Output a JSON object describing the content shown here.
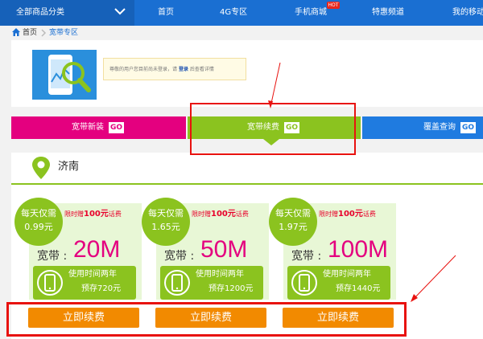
{
  "nav": {
    "category": "全部商品分类",
    "items": [
      "首页",
      "4G专区",
      "手机商城",
      "特惠频道",
      "我的移动"
    ],
    "hot_badge": "HOT"
  },
  "breadcrumb": {
    "home": "首页",
    "current": "宽带专区"
  },
  "notice": {
    "before": "尊敬的用户您目前尚未登录，请",
    "login": "登录",
    "after": "后查看详情"
  },
  "tabs": [
    {
      "label": "宽带新装",
      "go": "GO",
      "color": "#e4007f"
    },
    {
      "label": "宽带续费",
      "go": "GO",
      "color": "#8bc31f"
    },
    {
      "label": "覆盖查询",
      "go": "GO",
      "color": "#1f7be0"
    }
  ],
  "city": "济南",
  "plans": [
    {
      "daily_label": "每天仅需",
      "daily_price": "0.99元",
      "promo_pre": "限时赠",
      "promo_amount": "100元",
      "promo_post": "话费",
      "bb_label": "宽带 :",
      "speed": "20M",
      "use_period": "使用时间两年",
      "prestore": "预存720元",
      "button": "立即续费"
    },
    {
      "daily_label": "每天仅需",
      "daily_price": "1.65元",
      "promo_pre": "限时赠",
      "promo_amount": "100元",
      "promo_post": "话费",
      "bb_label": "宽带 :",
      "speed": "50M",
      "use_period": "使用时间两年",
      "prestore": "预存1200元",
      "button": "立即续费"
    },
    {
      "daily_label": "每天仅需",
      "daily_price": "1.97元",
      "promo_pre": "限时赠",
      "promo_amount": "100元",
      "promo_post": "话费",
      "bb_label": "宽带 :",
      "speed": "100M",
      "use_period": "使用时间两年",
      "prestore": "预存1440元",
      "button": "立即续费"
    }
  ],
  "colors": {
    "nav_blue": "#1a6fd2",
    "green": "#8bc31f",
    "magenta": "#e4007f",
    "orange": "#f28a00",
    "annotation_red": "#e8120f"
  }
}
